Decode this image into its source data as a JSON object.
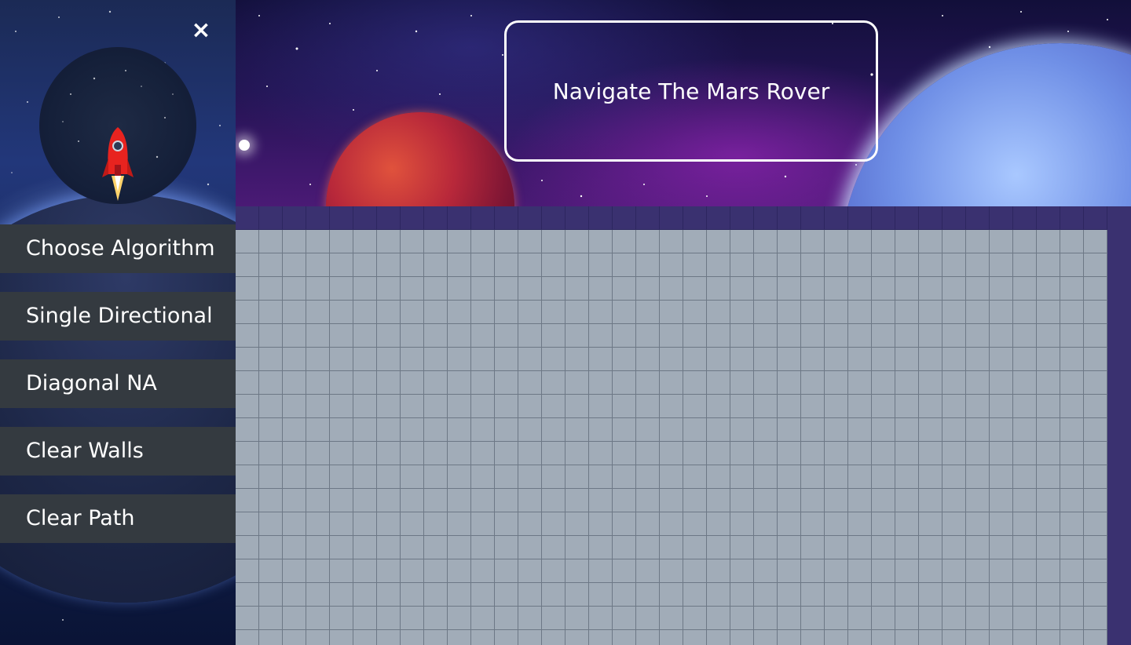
{
  "app": {
    "title": "Navigate The Mars Rover"
  },
  "sidebar": {
    "close_icon": "close-icon",
    "close_glyph": "×",
    "logo_icon": "rocket-icon",
    "items": [
      {
        "label": "Choose Algorithm"
      },
      {
        "label": "Single Directional"
      },
      {
        "label": "Diagonal NA"
      },
      {
        "label": "Clear Walls"
      },
      {
        "label": "Clear Path"
      }
    ]
  },
  "grid": {
    "columns": 37,
    "rows": 19
  },
  "colors": {
    "menu_button_bg": "#343a40",
    "grid_cell": "#a1acb8",
    "grid_line": "#6d7886",
    "frame": "#3a3170"
  }
}
